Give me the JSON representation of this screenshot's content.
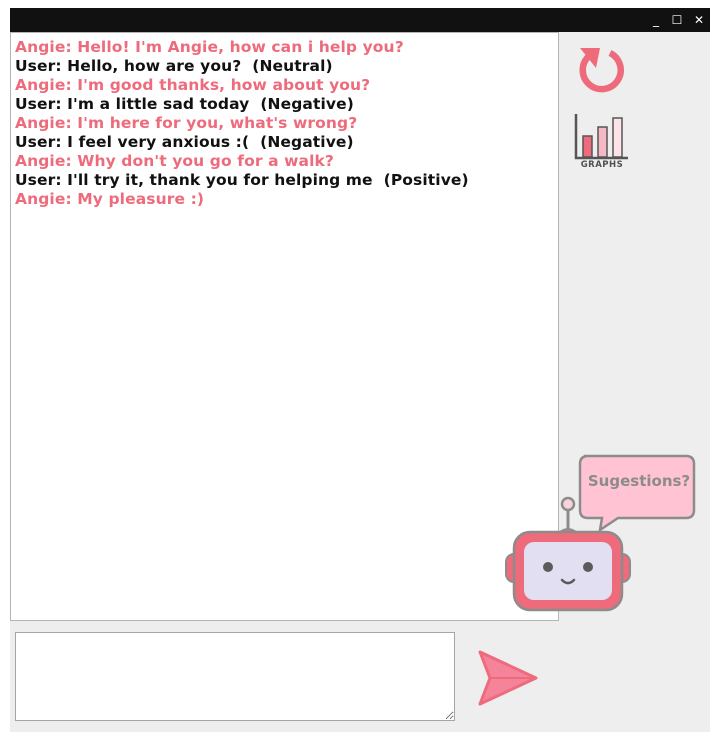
{
  "window": {
    "controls": {
      "minimize": "_",
      "maximize": "☐",
      "close": "✕"
    }
  },
  "chat": {
    "messages": [
      {
        "speaker": "Angie",
        "text": "Angie: Hello! I'm Angie, how can i help you?"
      },
      {
        "speaker": "User",
        "text": "User: Hello, how are you?  (Neutral)"
      },
      {
        "speaker": "Angie",
        "text": "Angie: I'm good thanks, how about you?"
      },
      {
        "speaker": "User",
        "text": "User: I'm a little sad today  (Negative)"
      },
      {
        "speaker": "Angie",
        "text": "Angie: I'm here for you, what's wrong?"
      },
      {
        "speaker": "User",
        "text": "User: I feel very anxious :(  (Negative)"
      },
      {
        "speaker": "Angie",
        "text": "Angie: Why don't you go for a walk?"
      },
      {
        "speaker": "User",
        "text": "User: I'll try it, thank you for helping me  (Positive)"
      },
      {
        "speaker": "Angie",
        "text": "Angie: My pleasure :)"
      }
    ]
  },
  "input": {
    "value": ""
  },
  "sidebar": {
    "refresh_icon": "refresh-icon",
    "graphs_icon": "bar-chart-icon",
    "graphs_label": "GRAPHS"
  },
  "assistant": {
    "bubble_text": "Sugestions?",
    "avatar_icon": "robot-icon"
  },
  "send": {
    "icon": "paper-plane-icon"
  },
  "colors": {
    "angie": "#ee6b7c",
    "user": "#111111",
    "accent": "#ee6b7c",
    "bubble": "#ffc3d3",
    "robot_face": "#e3dff3"
  }
}
